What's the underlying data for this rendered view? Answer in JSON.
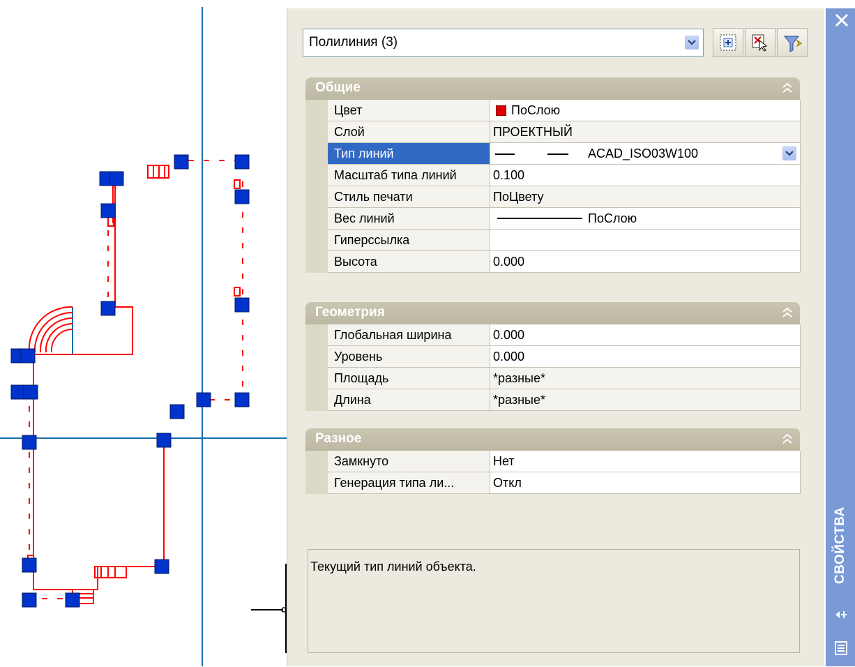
{
  "object_selector": {
    "value": "Полилиния (3)"
  },
  "toolbar": {
    "pickadd_icon": "pickadd-toggle-icon",
    "select_icon": "select-objects-icon",
    "quickselect_icon": "quick-select-icon"
  },
  "sections": {
    "general": {
      "title": "Общие",
      "rows": [
        {
          "name": "Цвет",
          "value": "ПоСлою"
        },
        {
          "name": "Слой",
          "value": "ПРОЕКТНЫЙ"
        },
        {
          "name": "Тип линий",
          "value": "ACAD_ISO03W100"
        },
        {
          "name": "Масштаб типа линий",
          "value": "0.100"
        },
        {
          "name": "Стиль печати",
          "value": "ПоЦвету"
        },
        {
          "name": "Вес линий",
          "value": "ПоСлою"
        },
        {
          "name": "Гиперссылка",
          "value": ""
        },
        {
          "name": "Высота",
          "value": "0.000"
        }
      ]
    },
    "geometry": {
      "title": "Геометрия",
      "rows": [
        {
          "name": "Глобальная ширина",
          "value": "0.000"
        },
        {
          "name": "Уровень",
          "value": "0.000"
        },
        {
          "name": "Площадь",
          "value": "*разные*"
        },
        {
          "name": "Длина",
          "value": "*разные*"
        }
      ]
    },
    "misc": {
      "title": "Разное",
      "rows": [
        {
          "name": "Замкнуто",
          "value": "Нет"
        },
        {
          "name": "Генерация типа ли...",
          "value": "Откл"
        }
      ]
    }
  },
  "description": "Текущий тип линий объекта.",
  "sidebar": {
    "label": "СВОЙСТВА"
  },
  "colors": {
    "palette_bg": "#eceade",
    "selected_row": "#316ac5",
    "sidebar": "#7a9ad6",
    "grip": "#0033cc",
    "polyline": "#ff0000",
    "crosshair": "#1a6ea8"
  }
}
